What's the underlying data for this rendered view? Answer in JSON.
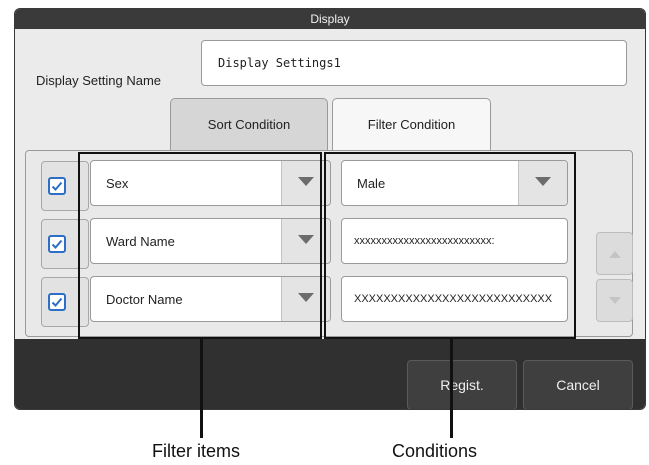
{
  "dialog": {
    "title": "Display",
    "setting_name_label": "Display Setting Name",
    "setting_name_value": "Display Settings1",
    "tabs": [
      {
        "label": "Sort Condition",
        "active": false
      },
      {
        "label": "Filter Condition",
        "active": true
      }
    ],
    "rows": [
      {
        "checked": true,
        "item": "Sex",
        "condition": "Male",
        "condition_type": "select"
      },
      {
        "checked": true,
        "item": "Ward Name",
        "condition": "xxxxxxxxxxxxxxxxxxxxxxxxx:",
        "condition_type": "text"
      },
      {
        "checked": true,
        "item": "Doctor Name",
        "condition": "XXXXXXXXXXXXXXXXXXXXXXXXXXX",
        "condition_type": "text"
      }
    ],
    "buttons": {
      "regist": "Regist.",
      "cancel": "Cancel"
    }
  },
  "annotations": {
    "filter_items": "Filter items",
    "conditions": "Conditions"
  },
  "colors": {
    "titlebar": "#3a3a3a",
    "checkbox_border": "#2d6ec7",
    "footer": "#303030"
  }
}
